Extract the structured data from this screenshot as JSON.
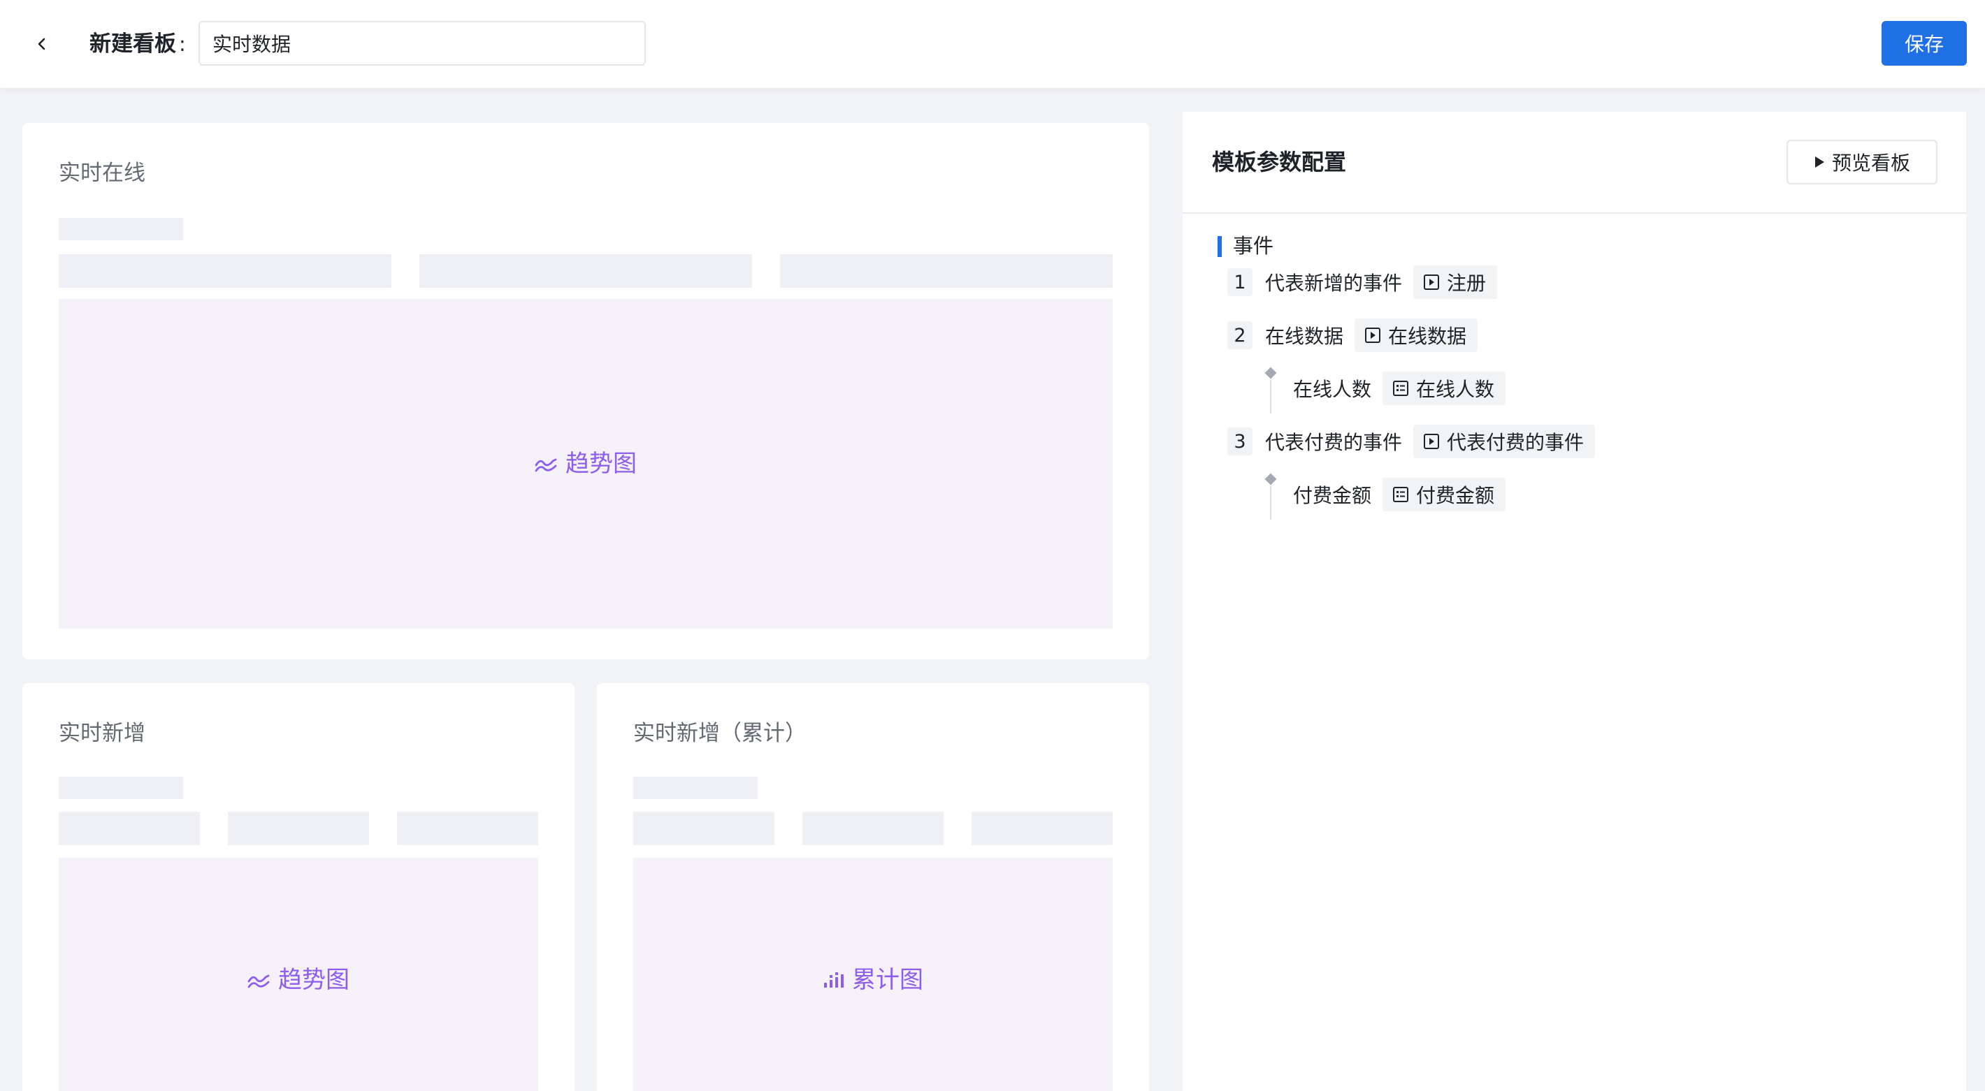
{
  "header": {
    "title_label": "新建看板",
    "title_colon": ":",
    "board_name": "实时数据",
    "save_label": "保存"
  },
  "cards": [
    {
      "title": "实时在线",
      "chart_label": "趋势图",
      "chart_icon": "trend-chart-icon"
    },
    {
      "title": "实时新增",
      "chart_label": "趋势图",
      "chart_icon": "trend-chart-icon"
    },
    {
      "title": "实时新增（累计）",
      "chart_label": "累计图",
      "chart_icon": "cumulative-chart-icon"
    }
  ],
  "panel": {
    "title": "模板参数配置",
    "preview_label": "预览看板",
    "section_title": "事件",
    "events": [
      {
        "num": "1",
        "label": "代表新增的事件",
        "tag": "注册",
        "tag_icon": "event-icon"
      },
      {
        "num": "2",
        "label": "在线数据",
        "tag": "在线数据",
        "tag_icon": "event-icon",
        "property": {
          "label": "在线人数",
          "tag": "在线人数",
          "tag_icon": "property-icon"
        }
      },
      {
        "num": "3",
        "label": "代表付费的事件",
        "tag": "代表付费的事件",
        "tag_icon": "event-icon",
        "property": {
          "label": "付费金额",
          "tag": "付费金额",
          "tag_icon": "property-icon"
        }
      }
    ]
  },
  "colors": {
    "primary": "#1f6fe5",
    "chart_accent": "#8f5cf0",
    "page_bg": "#f2f3f7"
  }
}
